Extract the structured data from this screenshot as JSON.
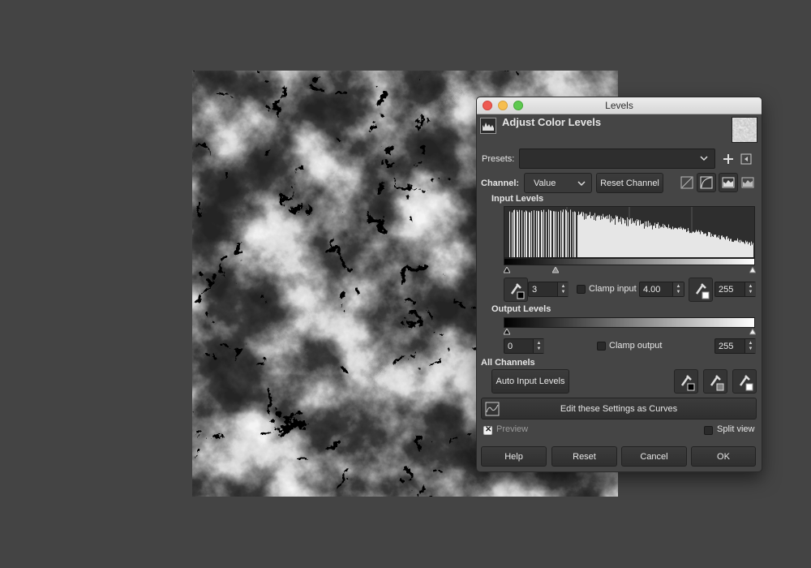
{
  "window": {
    "title": "Levels"
  },
  "header": {
    "title": "Adjust Color Levels"
  },
  "presets": {
    "label": "Presets:",
    "value": ""
  },
  "channel": {
    "label": "Channel:",
    "value": "Value",
    "reset_label": "Reset Channel"
  },
  "input_levels": {
    "heading": "Input Levels",
    "low_value": "3",
    "gamma_value": "4.00",
    "high_value": "255",
    "clamp_label": "Clamp input",
    "clamp_checked": false
  },
  "output_levels": {
    "heading": "Output Levels",
    "low_value": "0",
    "high_value": "255",
    "clamp_label": "Clamp output",
    "clamp_checked": false
  },
  "all_channels": {
    "heading": "All Channels",
    "auto_label": "Auto Input Levels"
  },
  "curves": {
    "label": "Edit these Settings as Curves"
  },
  "preview": {
    "label": "Preview",
    "checked": true
  },
  "split_view": {
    "label": "Split view",
    "checked": false
  },
  "buttons": {
    "help": "Help",
    "reset": "Reset",
    "cancel": "Cancel",
    "ok": "OK"
  },
  "colors": {
    "background": "#444444",
    "dialog": "#454545",
    "close": "#ee5a52",
    "minimize": "#f6be4f",
    "maximize": "#5ec950"
  },
  "icons": [
    "levels-icon",
    "image-thumbnail-icon",
    "chevron-down-icon",
    "add-preset-icon",
    "preset-menu-icon",
    "linear-histogram-icon",
    "log-histogram-icon",
    "histogram-mode-icon",
    "histogram-mode-alt-icon",
    "black-point-picker-icon",
    "gray-point-picker-icon",
    "white-point-picker-icon",
    "curves-icon"
  ]
}
